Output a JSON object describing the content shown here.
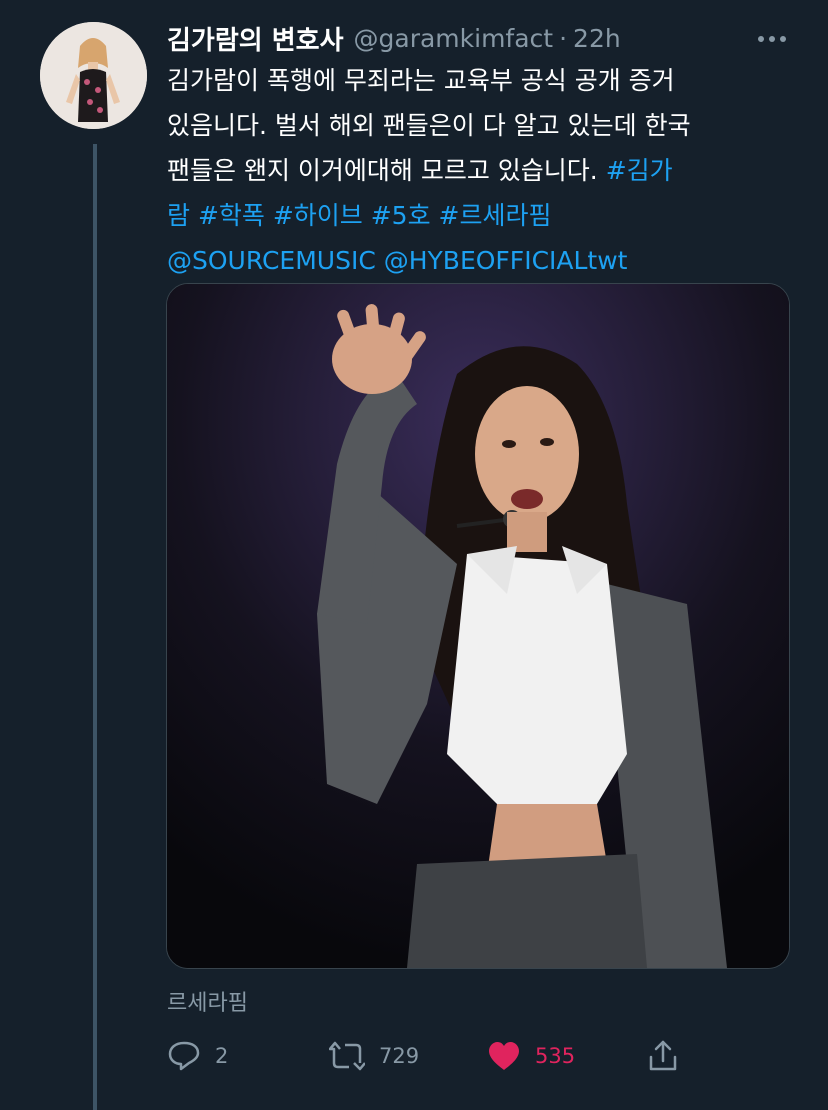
{
  "tweet": {
    "display_name": "김가람의 변호사",
    "handle": "@garamkimfact",
    "separator": "·",
    "time": "22h",
    "text_lines": [
      {
        "plain": "김가람이 폭행에 무죄라는 교육부 공식 공개 증거",
        "link": ""
      },
      {
        "plain": "있음니다. 벌서 해외 팬들은이 다 알고 있는데 한국",
        "link": ""
      },
      {
        "plain": "팬들은 왠지 이거에대해 모르고 있습니다. ",
        "link": "#김가"
      },
      {
        "plain": "",
        "link": "람 #학폭 #하이브 #5호 #르세라핌"
      },
      {
        "plain": "",
        "link": "@SOURCEMUSIC @HYBEOFFICIALtwt"
      }
    ],
    "media_caption": "르세라핌",
    "actions": {
      "reply": {
        "icon": "reply-icon",
        "count": "2"
      },
      "retweet": {
        "icon": "retweet-icon",
        "count": "729"
      },
      "like": {
        "icon": "heart-icon",
        "count": "535",
        "liked": true
      },
      "share": {
        "icon": "share-icon"
      }
    }
  },
  "colors": {
    "background": "#15202b",
    "link": "#1da1f2",
    "secondary_text": "#8899a6",
    "like": "#e0245e",
    "thread_line": "#3d5466"
  }
}
